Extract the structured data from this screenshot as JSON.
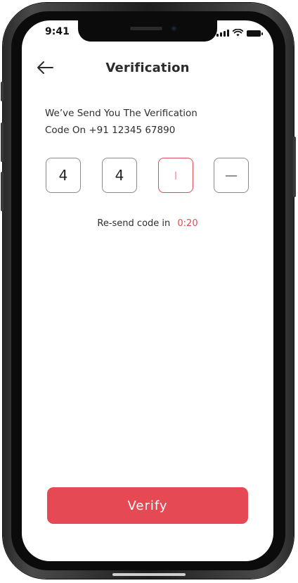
{
  "status_bar": {
    "time": "9:41",
    "icons": [
      "signal-icon",
      "wifi-icon",
      "battery-icon"
    ]
  },
  "header": {
    "back_icon": "arrow-left-icon",
    "title": "Verification"
  },
  "message": {
    "line1": "We’ve Send You The Verification",
    "line2": "Code On +91 12345 67890"
  },
  "otp": {
    "digits": [
      "4",
      "4",
      "I",
      "—"
    ]
  },
  "resend": {
    "label": "Re-send code in",
    "timer": "0:20"
  },
  "actions": {
    "verify_label": "Verify"
  },
  "colors": {
    "accent": "#e54954",
    "text": "#2b2b2b",
    "border": "#8a8a8a"
  }
}
